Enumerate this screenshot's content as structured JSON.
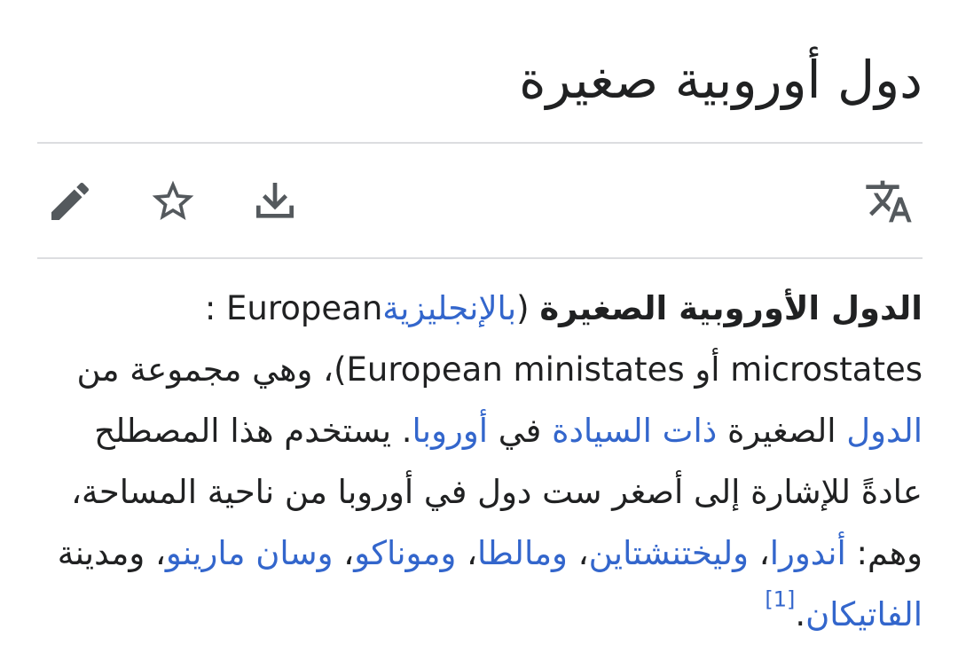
{
  "article": {
    "title": "دول أوروبية صغيرة"
  },
  "toolbar": {
    "edit_icon": "pencil-icon",
    "watch_icon": "star-icon",
    "download_icon": "download-icon",
    "language_icon": "translate-icon"
  },
  "lead": {
    "bold_term": "الدول الأوروبية الصغيرة",
    "paren_open": " (",
    "lang_link": "بالإنجليزية",
    "en_name_1": ": European microstates",
    "or_text": " أو ",
    "en_name_2": "European ministates",
    "after_names": ")، وهي مجموعة من ",
    "link_states": "الدول",
    "small_text": " الصغيرة ",
    "link_sovereign": "ذات السيادة",
    "in_text": " في ",
    "link_europe": "أوروبا",
    "sentence_2": ". يستخدم هذا المصطلح عادةً للإشارة إلى أصغر ست دول في أوروبا من ناحية المساحة، وهم: ",
    "link_andorra": "أندورا",
    "sep_1": "، ",
    "link_liechtenstein": "وليختنشتاين",
    "sep_2": "، ",
    "link_malta": "ومالطا",
    "sep_3": "، ",
    "link_monaco": "وموناكو",
    "sep_4": "، ",
    "link_sanmarino": "وسان مارينو",
    "and_text": "، ومدينة ",
    "link_vatican": "الفاتيكان",
    "end_dot": ".",
    "ref": "[1]"
  }
}
